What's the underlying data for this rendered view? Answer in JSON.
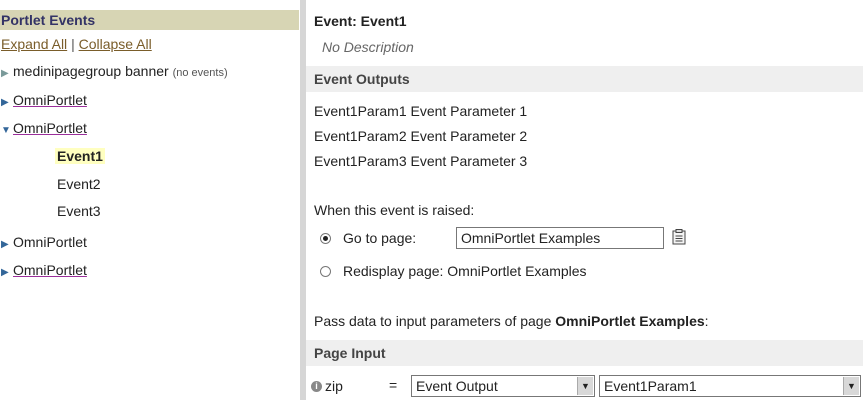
{
  "sidebar": {
    "title": "Portlet Events",
    "expand_all": "Expand All",
    "separator": "|",
    "collapse_all": "Collapse All",
    "items": [
      {
        "label": "medinipagegroup banner",
        "note": "(no events)"
      },
      {
        "label": "OmniPortlet"
      },
      {
        "label": "OmniPortlet",
        "events": [
          "Event1",
          "Event2",
          "Event3"
        ]
      },
      {
        "label": "OmniPortlet"
      },
      {
        "label": "OmniPortlet"
      }
    ]
  },
  "event": {
    "title": "Event: Event1",
    "description": "No Description"
  },
  "outputs": {
    "header": "Event Outputs",
    "lines": [
      "Event1Param1 Event Parameter 1",
      "Event1Param2 Event Parameter 2",
      "Event1Param3 Event Parameter 3"
    ]
  },
  "raised": {
    "label": "When this event is raised:",
    "go_to_page_label": "Go to page:",
    "go_to_page_value": "OmniPortlet Examples",
    "redisplay_label": "Redisplay page: OmniPortlet Examples",
    "selected": "go_to_page"
  },
  "pass_data": {
    "prefix": "Pass data to input parameters of page ",
    "page_name": "OmniPortlet Examples",
    "suffix": ":"
  },
  "page_input": {
    "header": "Page Input",
    "param_name": "zip",
    "equals": "=",
    "source_value": "Event Output",
    "param_value": "Event1Param1"
  }
}
